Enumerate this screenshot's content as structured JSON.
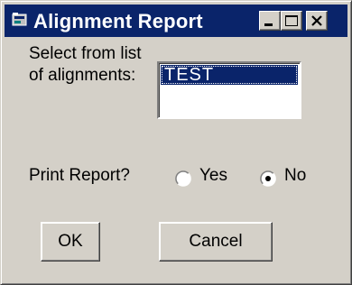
{
  "window": {
    "title": "Alignment Report",
    "titlebar_color": "#0a246a",
    "face_color": "#d4d0c8",
    "controls": [
      "minimize-icon",
      "maximize-icon",
      "close-icon"
    ]
  },
  "list": {
    "label_line1": "Select from list",
    "label_line2": "of alignments:",
    "items": [
      "TEST"
    ],
    "selected": "TEST"
  },
  "print": {
    "label": "Print Report?",
    "options": [
      {
        "label": "Yes",
        "checked": false
      },
      {
        "label": "No",
        "checked": true
      }
    ]
  },
  "buttons": {
    "ok": "OK",
    "cancel": "Cancel"
  }
}
